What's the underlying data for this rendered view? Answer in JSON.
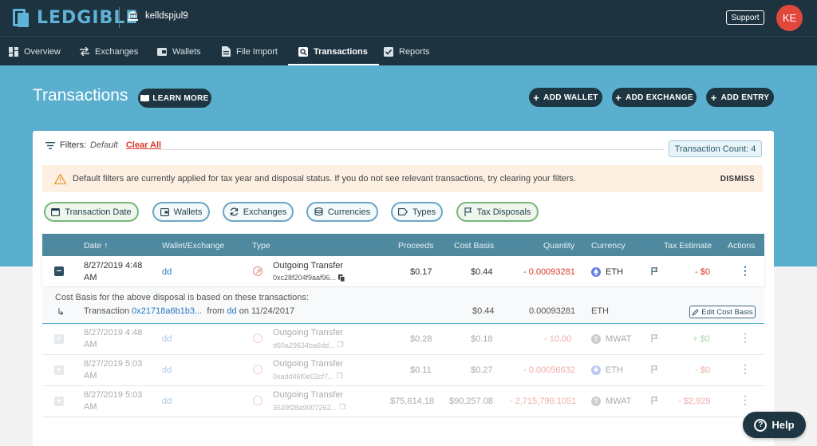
{
  "app": {
    "brand": "LEDGIBLE",
    "account": "kelldspjul9",
    "support_label": "Support",
    "avatar_initials": "KE"
  },
  "nav": {
    "items": [
      {
        "label": "Overview",
        "icon": "dashboard-icon"
      },
      {
        "label": "Exchanges",
        "icon": "swap-arrows-icon"
      },
      {
        "label": "Wallets",
        "icon": "wallet-icon"
      },
      {
        "label": "File Import",
        "icon": "file-icon"
      },
      {
        "label": "Transactions",
        "icon": "search-doc-icon",
        "active": true
      },
      {
        "label": "Reports",
        "icon": "checkbox-icon"
      }
    ]
  },
  "page": {
    "title": "Transactions",
    "learn_more": "LEARN MORE",
    "add_wallet": "ADD WALLET",
    "add_exchange": "ADD EXCHANGE",
    "add_entry": "ADD ENTRY"
  },
  "filters": {
    "label": "Filters:",
    "value": "Default",
    "clear": "Clear All",
    "count_label": "Transaction Count:",
    "count_value": "4"
  },
  "alert": {
    "message": "Default filters are currently applied for tax year and disposal status. If you do not see relevant transactions, try clearing your filters.",
    "dismiss": "DISMISS"
  },
  "chips": [
    "Transaction Date",
    "Wallets",
    "Exchanges",
    "Currencies",
    "Types",
    "Tax Disposals"
  ],
  "table": {
    "headers": {
      "date": "Date",
      "wallet": "Wallet/Exchange",
      "type": "Type",
      "proceeds": "Proceeds",
      "cost_basis": "Cost Basis",
      "quantity": "Quantity",
      "currency": "Currency",
      "tax_estimate": "Tax Estimate",
      "actions": "Actions"
    },
    "rows": [
      {
        "date1": "8/27/2019 4:48",
        "date2": "AM",
        "wallet": "dd",
        "type": "Outgoing Transfer",
        "hash": "0xc28f204f9aaf96...",
        "proceeds": "$0.17",
        "cost_basis": "$0.44",
        "quantity": "- 0.00093281",
        "currency": "ETH",
        "tax": "- $0"
      },
      {
        "date1": "8/27/2019 4:48",
        "date2": "AM",
        "wallet": "dd",
        "type": "Outgoing Transfer",
        "hash": "d60a29634ba6dd...",
        "proceeds": "$0.28",
        "cost_basis": "$0.18",
        "quantity": "- 10.00",
        "currency": "MWAT",
        "tax": "+ $0"
      },
      {
        "date1": "8/27/2019 5:03",
        "date2": "AM",
        "wallet": "dd",
        "type": "Outgoing Transfer",
        "hash": "0xadd46f0e02cf7...",
        "proceeds": "$0.11",
        "cost_basis": "$0.27",
        "quantity": "- 0.00056632",
        "currency": "ETH",
        "tax": "- $0"
      },
      {
        "date1": "8/27/2019 5:03",
        "date2": "AM",
        "wallet": "dd",
        "type": "Outgoing Transfer",
        "hash": "3639f28a9007262...",
        "proceeds": "$75,614.18",
        "cost_basis": "$90,257.08",
        "quantity": "- 2,715,799.1051",
        "currency": "MWAT",
        "tax": "- $2,929"
      }
    ],
    "subrow": {
      "note": "Cost Basis for the above disposal is based on these transactions:",
      "tx_label": "Transaction",
      "tx_hash": "0x21718a6b1b3...",
      "from_label": "from",
      "from_wallet": "dd",
      "on_label": "on 11/24/2017",
      "cost_basis": "$0.44",
      "quantity": "0.00093281",
      "currency": "ETH",
      "edit": "Edit Cost Basis"
    }
  },
  "help": "Help"
}
